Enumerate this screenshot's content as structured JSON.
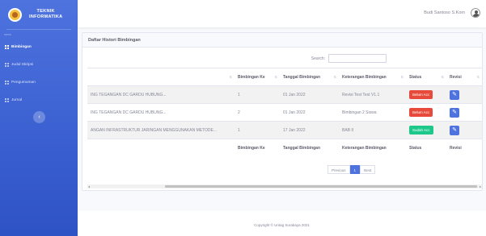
{
  "sidebar": {
    "brand_line1": "TEKNIK",
    "brand_line2": "INFORMATIKA",
    "heading": "menu",
    "items": [
      {
        "label": "Bimbingan",
        "icon": "grid-icon",
        "active": true
      },
      {
        "label": "Judul Skripsi",
        "icon": "grid-icon",
        "active": false
      },
      {
        "label": "Pengumuman",
        "icon": "grid-icon",
        "active": false
      },
      {
        "label": "Jurnal",
        "icon": "grid-icon",
        "active": false
      }
    ],
    "toggle_icon": "chevron-left-icon"
  },
  "topbar": {
    "user_name": "Budi Santoso S.Kom",
    "avatar_icon": "user-avatar-icon"
  },
  "card": {
    "title": "Daftar Histori Bimbingan",
    "search_label": "Search:",
    "search_value": ""
  },
  "table": {
    "columns": [
      "",
      "Bimbingan Ke",
      "Tanggal Bimbingan",
      "Keterangan Bimbingan",
      "Status",
      "Revisi"
    ],
    "rows": [
      {
        "judul": "ING TEGANGAN DC GARDU HUBUNG...",
        "ke": "1",
        "tanggal": "01 Jan 2022",
        "keterangan": "Revisi Test Test V1.1",
        "status": "Belum Acc",
        "status_color": "#e74a3b"
      },
      {
        "judul": "ING TEGANGAN DC GARDU HUBUNG...",
        "ke": "2",
        "tanggal": "01 Jan 2022",
        "keterangan": "Bimbingan 2 Siswa",
        "status": "Belum Acc",
        "status_color": "#e74a3b"
      },
      {
        "judul": "ANGAN INFRASTRUKTUR JARINGAN MENGGUNAKAN METODE...",
        "ke": "1",
        "tanggal": "17 Jan 2022",
        "keterangan": "BAB II",
        "status": "Sudah Acc",
        "status_color": "#1cc88a"
      }
    ],
    "footer_columns": [
      "",
      "Bimbingan Ke",
      "Tanggal Bimbingan",
      "Keterangan Bimbingan",
      "Status",
      "Revisi"
    ]
  },
  "pagination": {
    "previous": "Previous",
    "current": "1",
    "next": "Next"
  },
  "footer": {
    "copyright": "Copyright © Untag Surabaya 2021"
  },
  "colors": {
    "primary": "#4e73df",
    "danger": "#e74a3b",
    "success": "#1cc88a"
  }
}
